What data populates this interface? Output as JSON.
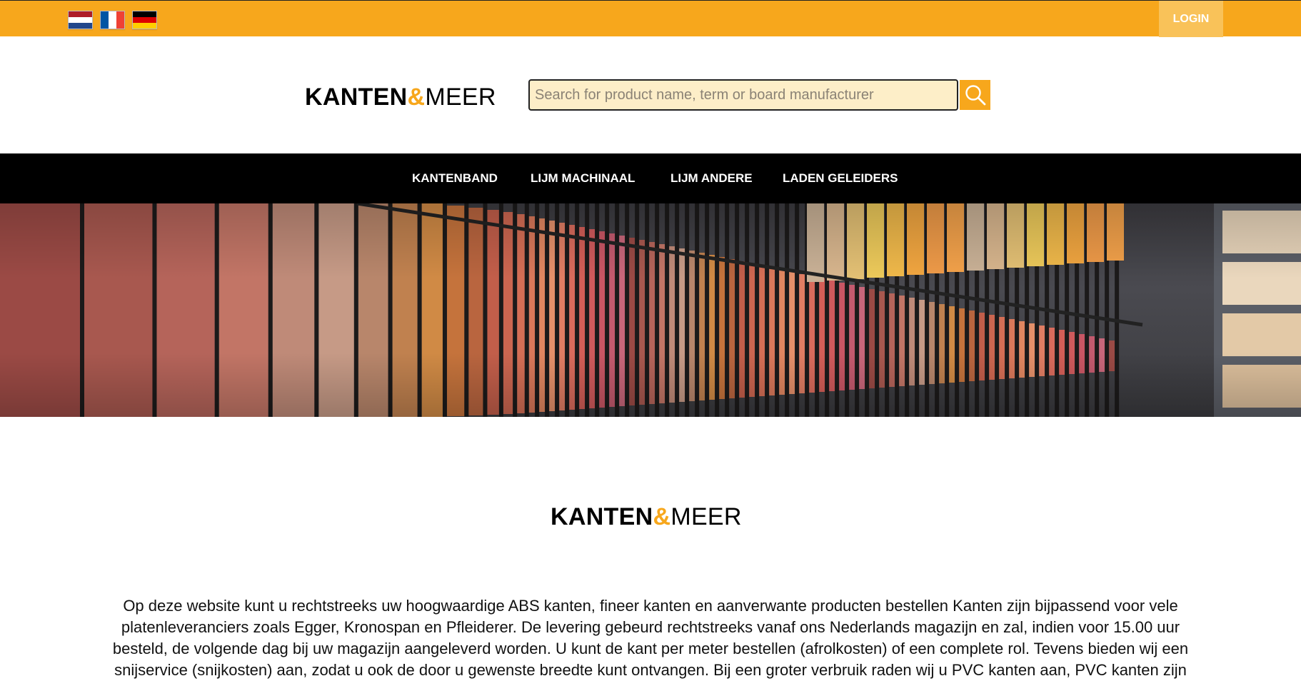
{
  "topbar": {
    "flags": [
      {
        "name": "dutch-flag",
        "colors": [
          "#ae1c28",
          "#ffffff",
          "#21468b"
        ]
      },
      {
        "name": "french-flag",
        "colors": [
          "#0055a4",
          "#ffffff",
          "#ef4135"
        ]
      },
      {
        "name": "german-flag",
        "colors": [
          "#000000",
          "#dd0000",
          "#ffce00"
        ]
      }
    ],
    "login_label": "LOGIN"
  },
  "logo": {
    "part1": "KANTEN",
    "amp": "&",
    "part2": "MEER"
  },
  "search": {
    "placeholder": "Search for product name, term or board manufacturer",
    "value": "",
    "icon": "search-icon"
  },
  "nav": {
    "items": [
      {
        "label": "KANTENBAND"
      },
      {
        "label": "LIJM MACHINAAL"
      },
      {
        "label": "LIJM ANDERE"
      },
      {
        "label": "LADEN GELEIDERS"
      }
    ]
  },
  "content": {
    "intro": "Op deze website kunt u rechtstreeks uw hoogwaardige ABS kanten, fineer kanten en aanverwante producten bestellen Kanten zijn bijpassend voor vele platenleveranciers zoals Egger, Kronospan en Pfleiderer. De levering gebeurd rechtstreeks vanaf ons Nederlands magazijn en zal, indien voor 15.00 uur besteld, de volgende dag bij uw magazijn aangeleverd worden. U kunt de kant per meter bestellen (afrolkosten) of een complete rol. Tevens bieden wij een snijservice (snijkosten) aan, zodat u ook de door u gewenste breedte kunt ontvangen. Bij een groter verbruik raden wij u PVC kanten aan, PVC kanten zijn"
  },
  "colors": {
    "accent": "#f7a71c",
    "nav_bg": "#000000",
    "search_bg": "#fdeec8",
    "login_bg": "#f9c259"
  }
}
